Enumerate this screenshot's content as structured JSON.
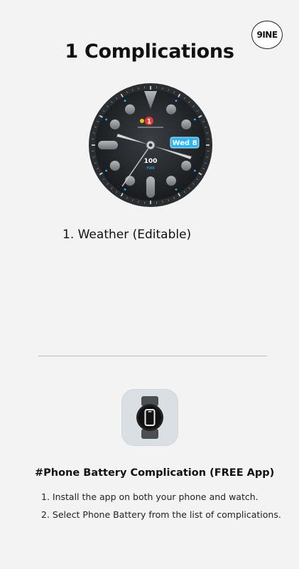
{
  "brand": {
    "logo_text": "9INE"
  },
  "header": {
    "title": "1 Complications"
  },
  "watch_face": {
    "date_label": "Wed 8",
    "battery_value": "100",
    "battery_unit": "PWR",
    "notification_count": "1",
    "accent_color": "#29b6f6"
  },
  "complications": {
    "items": [
      "1. Weather (Editable)"
    ]
  },
  "app": {
    "icon_name": "phone-battery-app-icon",
    "section_title": "#Phone Battery Complication (FREE App)",
    "steps": [
      "1. Install the app on both your phone and watch.",
      "2. Select Phone Battery from the list of complications."
    ]
  }
}
